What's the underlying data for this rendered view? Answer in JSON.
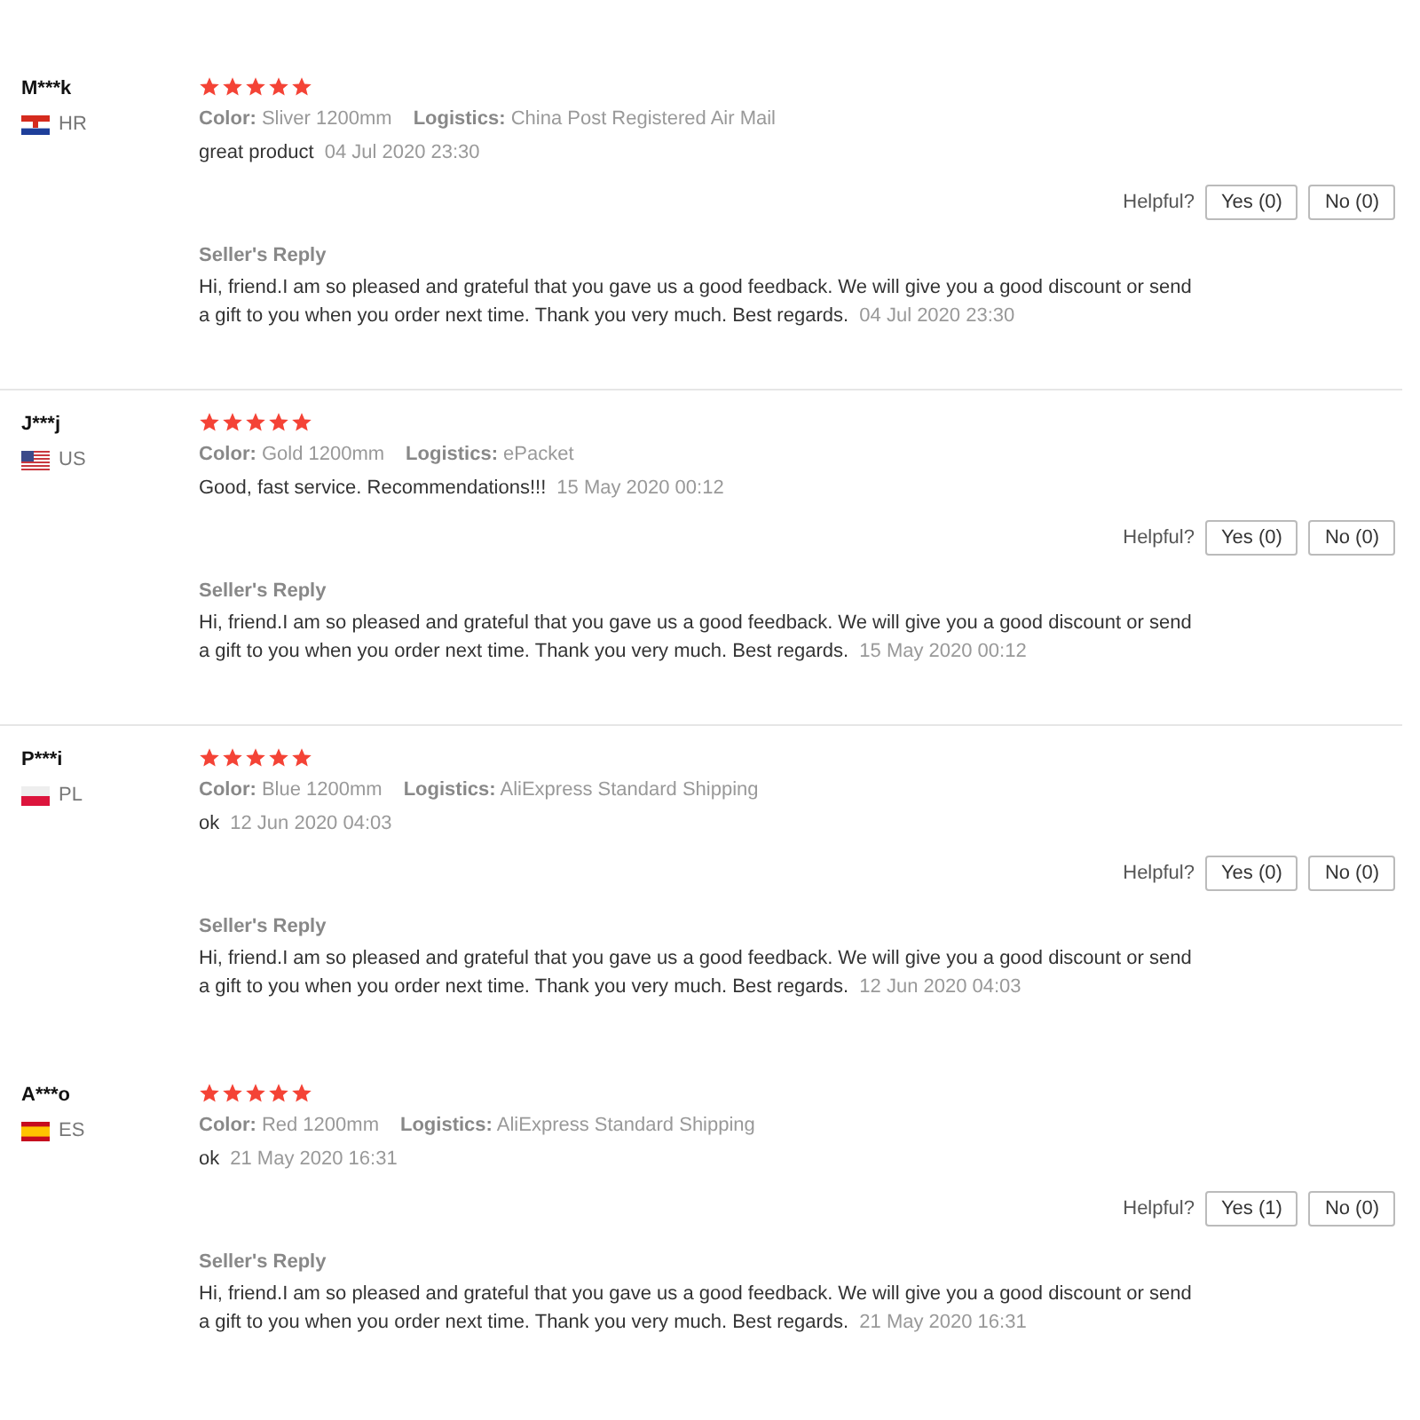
{
  "reviews": [
    {
      "user": "M***k",
      "country": "HR",
      "kind": "hr",
      "stars": 5,
      "color_label": "Color:",
      "variant": "Sliver 1200mm",
      "logistics_label": "Logistics:",
      "logistics": "China Post Registered Air Mail",
      "comment": "great product",
      "date": "04 Jul 2020 23:30",
      "helpful": "Helpful?",
      "yes": "Yes (0)",
      "no": "No (0)",
      "reply_title": "Seller's Reply",
      "reply": "Hi, friend.I am so pleased and grateful that you gave us a good feedback. We will give you a good discount or send a gift to you when you order next time. Thank you very much. Best regards.",
      "reply_date": "04 Jul 2020 23:30",
      "divider": true
    },
    {
      "user": "J***j",
      "country": "US",
      "kind": "us",
      "stars": 5,
      "color_label": "Color:",
      "variant": "Gold 1200mm",
      "logistics_label": "Logistics:",
      "logistics": "ePacket",
      "comment": "Good, fast service. Recommendations!!!",
      "date": "15 May 2020 00:12",
      "helpful": "Helpful?",
      "yes": "Yes (0)",
      "no": "No (0)",
      "reply_title": "Seller's Reply",
      "reply": "Hi, friend.I am so pleased and grateful that you gave us a good feedback. We will give you a good discount or send a gift to you when you order next time. Thank you very much. Best regards.",
      "reply_date": "15 May 2020 00:12",
      "divider": true
    },
    {
      "user": "P***i",
      "country": "PL",
      "kind": "pl",
      "stars": 5,
      "color_label": "Color:",
      "variant": "Blue 1200mm",
      "logistics_label": "Logistics:",
      "logistics": "AliExpress Standard Shipping",
      "comment": "ok",
      "date": "12 Jun 2020 04:03",
      "helpful": "Helpful?",
      "yes": "Yes (0)",
      "no": "No (0)",
      "reply_title": "Seller's Reply",
      "reply": "Hi, friend.I am so pleased and grateful that you gave us a good feedback. We will give you a good discount or send a gift to you when you order next time. Thank you very much. Best regards.",
      "reply_date": "12 Jun 2020 04:03",
      "divider": false
    },
    {
      "user": "A***o",
      "country": "ES",
      "kind": "es",
      "stars": 5,
      "color_label": "Color:",
      "variant": "Red 1200mm",
      "logistics_label": "Logistics:",
      "logistics": "AliExpress Standard Shipping",
      "comment": "ok",
      "date": "21 May 2020 16:31",
      "helpful": "Helpful?",
      "yes": "Yes (1)",
      "no": "No (0)",
      "reply_title": "Seller's Reply",
      "reply": "Hi, friend.I am so pleased and grateful that you gave us a good feedback. We will give you a good discount or send a gift to you when you order next time. Thank you very much. Best regards.",
      "reply_date": "21 May 2020 16:31",
      "divider": false
    }
  ]
}
